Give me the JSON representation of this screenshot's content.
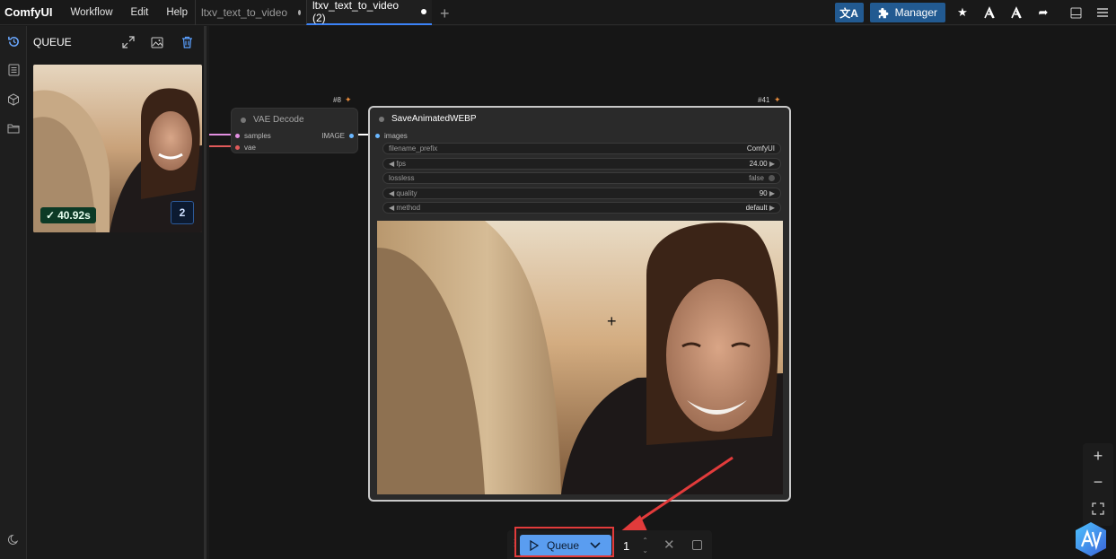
{
  "app": {
    "name": "ComfyUI",
    "menu": [
      "Workflow",
      "Edit",
      "Help"
    ]
  },
  "tabs": [
    {
      "label": "ltxv_text_to_video",
      "active": false
    },
    {
      "label": "ltxv_text_to_video (2)",
      "active": true
    }
  ],
  "toolbar": {
    "manager_label": "Manager",
    "icons": [
      "translate-icon",
      "puzzle-icon",
      "star-icon",
      "model-icon",
      "model-alt-icon",
      "share-icon",
      "panel-icon",
      "hamburger-icon"
    ]
  },
  "sidebar": {
    "icons": [
      "history-icon",
      "node-library-icon",
      "model-library-icon",
      "workflows-icon",
      "theme-icon"
    ]
  },
  "queue_panel": {
    "title": "QUEUE",
    "items": [
      {
        "duration": "40.92s",
        "count": "2"
      }
    ]
  },
  "nodes": {
    "vae_decode": {
      "id": "#8",
      "title": "VAE Decode",
      "inputs": [
        "samples",
        "vae"
      ],
      "output": "IMAGE"
    },
    "save_webp": {
      "id": "#41",
      "title": "SaveAnimatedWEBP",
      "input": "images",
      "widgets": [
        {
          "label": "filename_prefix",
          "value": "ComfyUI"
        },
        {
          "label": "fps",
          "value": "24.00"
        },
        {
          "label": "lossless",
          "value": "false"
        },
        {
          "label": "quality",
          "value": "90"
        },
        {
          "label": "method",
          "value": "default"
        }
      ]
    }
  },
  "canvas_controls": [
    "zoom-in-icon",
    "zoom-out-icon",
    "fit-view-icon"
  ],
  "bottom_bar": {
    "queue_label": "Queue",
    "batch_count": "1"
  },
  "colors": {
    "accent": "#3b82f6",
    "queue_button": "#5a9df0",
    "manager_bg": "#225a91",
    "highlight": "#e23b3b",
    "time_badge": "#0c3a26"
  }
}
